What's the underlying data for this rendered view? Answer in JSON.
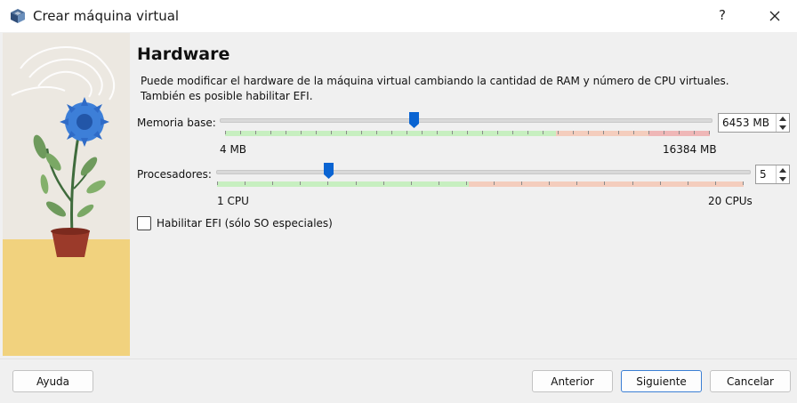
{
  "window": {
    "title": "Crear máquina virtual",
    "help_label": "?"
  },
  "page": {
    "title": "Hardware",
    "description_line1": "Puede modificar el hardware de la máquina virtual cambiando la cantidad de RAM y número de CPU virtuales.",
    "description_line2": "También es posible habilitar EFI."
  },
  "memory": {
    "label": "Memoria base:",
    "value": "6453 MB",
    "value_mb": 6453,
    "min_label": "4 MB",
    "max_label": "16384 MB",
    "min": 4,
    "max": 16384
  },
  "processors": {
    "label": "Procesadores:",
    "value": "5",
    "value_num": 5,
    "min_label": "1 CPU",
    "max_label": "20 CPUs",
    "min": 1,
    "max": 20
  },
  "efi": {
    "label": "Habilitar EFI (sólo SO especiales)",
    "checked": false
  },
  "buttons": {
    "help": "Ayuda",
    "back": "Anterior",
    "next": "Siguiente",
    "cancel": "Cancelar"
  },
  "colors": {
    "zone_ok": "#c7efc0",
    "zone_warn": "#f4cdbd",
    "zone_danger": "#efb7b7",
    "thumb": "#0a64d2",
    "accent": "#3b7fd4"
  },
  "icons": {
    "app": "virtualbox-cube-icon",
    "close": "close-icon",
    "spin_up": "arrow-up-icon",
    "spin_down": "arrow-down-icon"
  }
}
